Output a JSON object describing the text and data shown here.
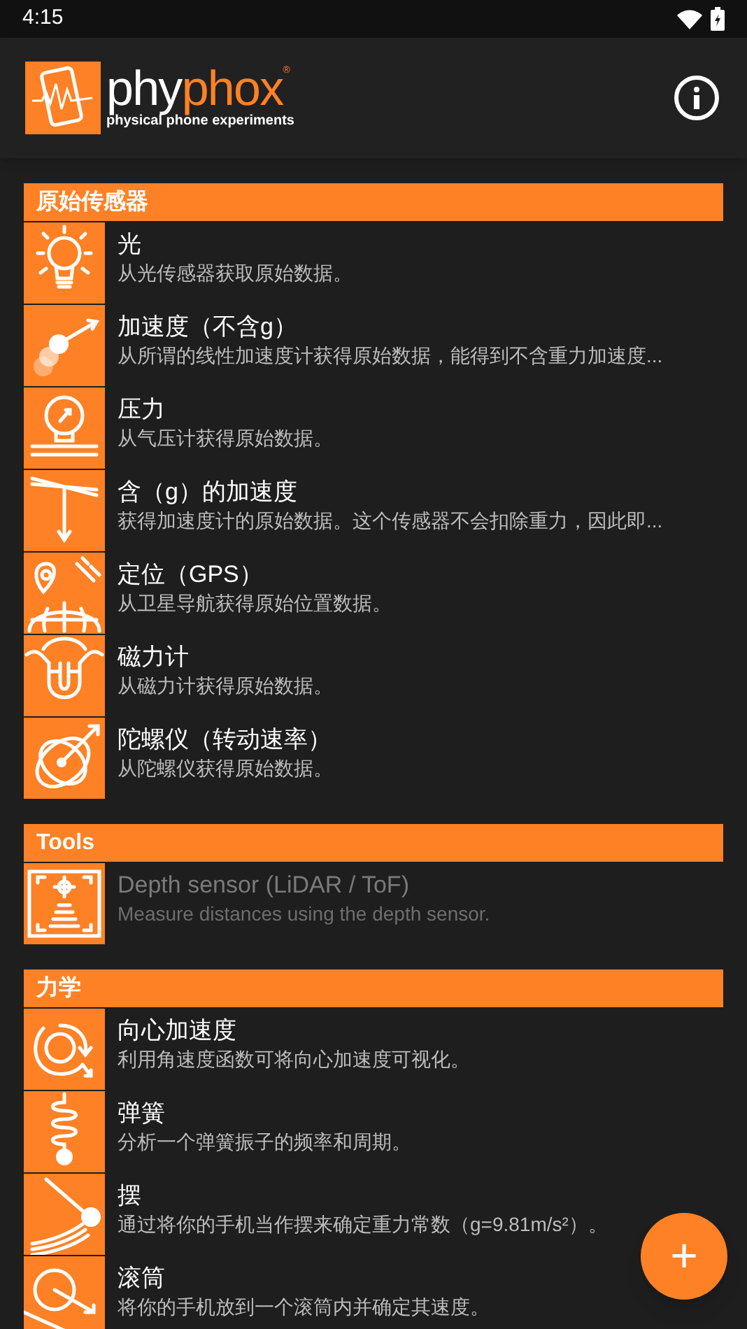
{
  "status_bar": {
    "time": "4:15"
  },
  "app_bar": {
    "logo": {
      "name_first": "phy",
      "name_second": "phox",
      "mark": "®",
      "tagline": "physical phone experiments"
    }
  },
  "sections": [
    {
      "title": "原始传感器",
      "items": [
        {
          "title": "光",
          "description": "从光传感器获取原始数据。",
          "disabled": false
        },
        {
          "title": "加速度（不含g）",
          "description": "从所谓的线性加速度计获得原始数据，能得到不含重力加速度...",
          "disabled": false
        },
        {
          "title": "压力",
          "description": "从气压计获得原始数据。",
          "disabled": false
        },
        {
          "title": "含（g）的加速度",
          "description": "获得加速度计的原始数据。这个传感器不会扣除重力，因此即...",
          "disabled": false
        },
        {
          "title": "定位（GPS）",
          "description": "从卫星导航获得原始位置数据。",
          "disabled": false
        },
        {
          "title": "磁力计",
          "description": "从磁力计获得原始数据。",
          "disabled": false
        },
        {
          "title": "陀螺仪（转动速率）",
          "description": "从陀螺仪获得原始数据。",
          "disabled": false
        }
      ]
    },
    {
      "title": "Tools",
      "items": [
        {
          "title": "Depth sensor (LiDAR / ToF)",
          "description": "Measure distances using the depth sensor.",
          "disabled": true
        }
      ]
    },
    {
      "title": "力学",
      "items": [
        {
          "title": "向心加速度",
          "description": "利用角速度函数可将向心加速度可视化。",
          "disabled": false
        },
        {
          "title": "弹簧",
          "description": "分析一个弹簧振子的频率和周期。",
          "disabled": false
        },
        {
          "title": "摆",
          "description": "通过将你的手机当作摆来确定重力常数（g=9.81m/s²）。",
          "disabled": false
        },
        {
          "title": "滚筒",
          "description": "将你的手机放到一个滚筒内并确定其速度。",
          "disabled": false
        }
      ]
    }
  ],
  "fab": {
    "label": "+"
  }
}
